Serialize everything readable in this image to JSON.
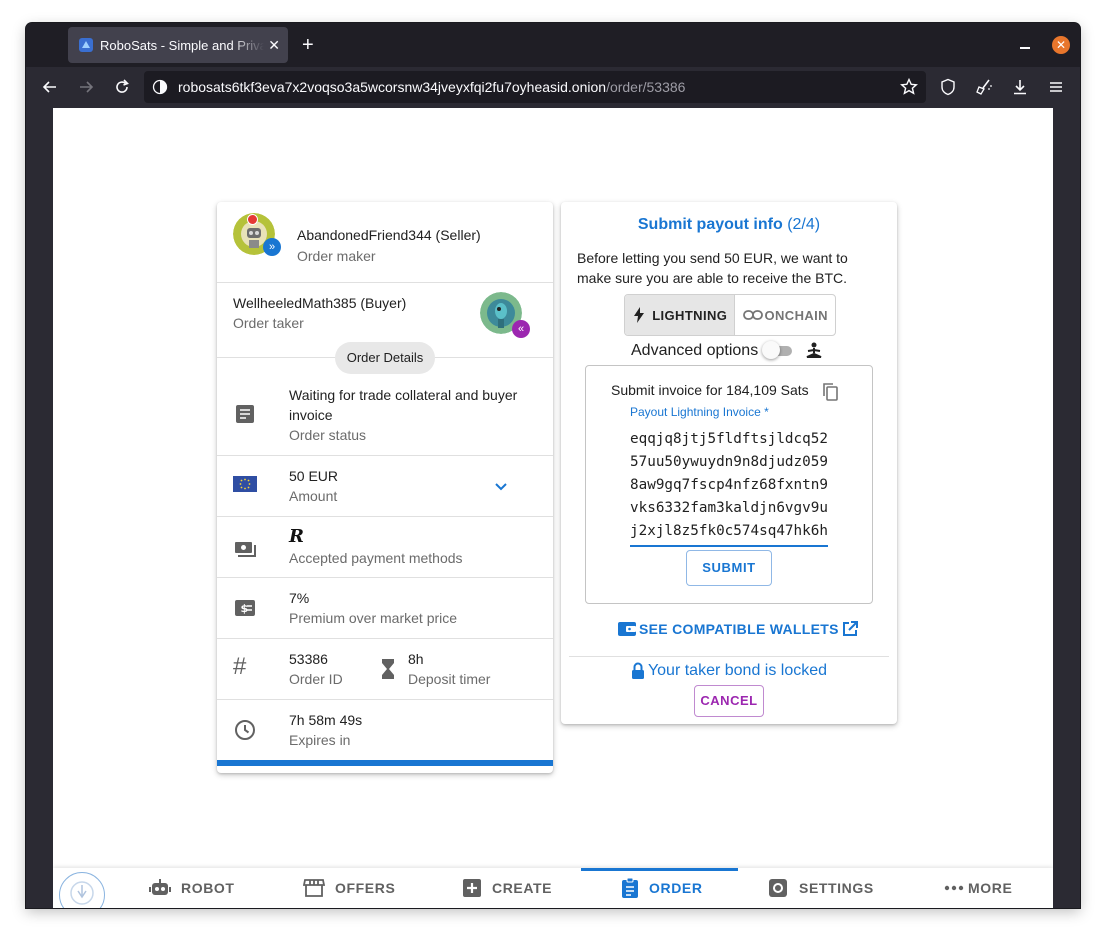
{
  "browser": {
    "tab_title": "RoboSats - Simple and Private",
    "url_domain": "robosats6tkf3eva7x2voqso3a5wcorsnw34jveyxfqi2fu7oyheasid.onion",
    "url_path": "/order/53386"
  },
  "order_card": {
    "maker_name": "AbandonedFriend344 (Seller)",
    "maker_role": "Order maker",
    "taker_name": "WellheeledMath385 (Buyer)",
    "taker_role": "Order taker",
    "details_chip": "Order Details",
    "status_value": "Waiting for trade collateral and buyer invoice",
    "status_label": "Order status",
    "amount_value": "50 EUR",
    "amount_label": "Amount",
    "payment_method_symbol": "R",
    "payment_label": "Accepted payment methods",
    "premium_value": "7%",
    "premium_label": "Premium over market price",
    "order_id_value": "53386",
    "order_id_label": "Order ID",
    "deposit_value": "8h",
    "deposit_label": "Deposit timer",
    "expires_value": "7h 58m 49s",
    "expires_label": "Expires in",
    "progress_percent": 100
  },
  "payout": {
    "title": "Submit payout info",
    "step": "(2/4)",
    "description": "Before letting you send 50 EUR, we want to make sure you are able to receive the BTC.",
    "lightning_label": "LIGHTNING",
    "onchain_label": "ONCHAIN",
    "advanced_label": "Advanced options",
    "advanced_enabled": false,
    "invoice_title": "Submit invoice for 184,109 Sats",
    "invoice_field_label": "Payout Lightning Invoice *",
    "invoice_value": "eqqjq8jtj5fldftsjldcq5257uu50ywuydn9n8djudz0598aw9gq7fscp4nfz68fxntn9vks6332fam3kaldjn6vgv9uj2xjl8z5fk0c574sq47hk6h",
    "submit_label": "SUBMIT",
    "wallets_label": "SEE COMPATIBLE WALLETS",
    "bond_text": "Your taker bond is locked",
    "cancel_label": "CANCEL"
  },
  "bottom_nav": {
    "robot": "ROBOT",
    "offers": "OFFERS",
    "create": "CREATE",
    "order": "ORDER",
    "settings": "SETTINGS",
    "more": "MORE",
    "active": "order"
  },
  "colors": {
    "accent": "#1976d2",
    "secondary": "#9c27b0",
    "browser_chrome": "#2b2a33"
  }
}
